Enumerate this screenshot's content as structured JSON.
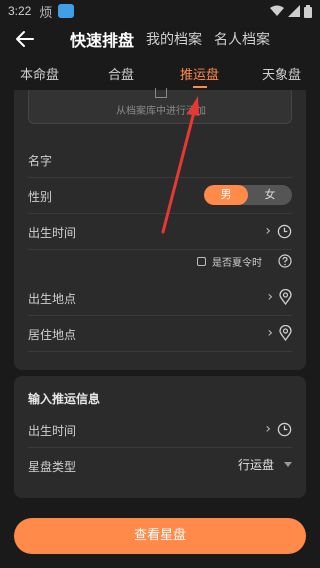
{
  "status_bar": {
    "time": "3:22",
    "app_icon_text": "烦"
  },
  "header": {
    "tabs": [
      {
        "label": "快速排盘",
        "active": true
      },
      {
        "label": "我的档案",
        "active": false
      },
      {
        "label": "名人档案",
        "active": false
      }
    ]
  },
  "tabs": [
    {
      "label": "本命盘"
    },
    {
      "label": "合盘"
    },
    {
      "label": "推运盘",
      "active": true
    },
    {
      "label": "天象盘"
    }
  ],
  "card1": {
    "upload_text": "从档案库中进行添加",
    "name_label": "名字",
    "gender_label": "性别",
    "gender_options": [
      "男",
      "女"
    ],
    "gender_selected": "男",
    "birth_time_label": "出生时间",
    "dst_label": "是否夏令时",
    "birth_place_label": "出生地点",
    "residence_label": "居住地点"
  },
  "card2": {
    "title": "输入推运信息",
    "birth_time_label": "出生时间",
    "chart_type_label": "星盘类型",
    "chart_type_value": "行运盘"
  },
  "submit_label": "查看星盘",
  "colors": {
    "accent": "#ff8a4a",
    "annotation_arrow": "#e53935"
  }
}
